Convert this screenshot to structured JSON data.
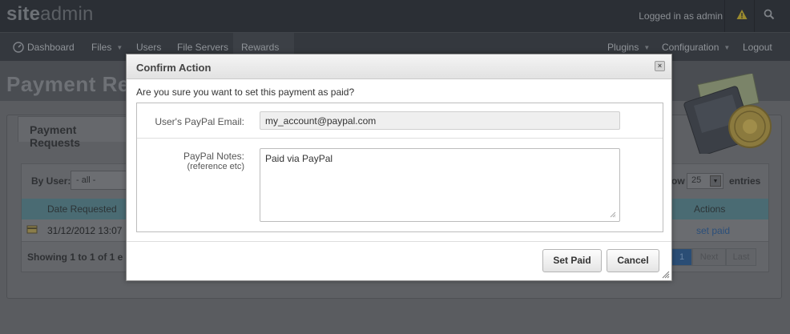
{
  "app": {
    "brand_site": "site",
    "brand_admin": "admin"
  },
  "topbar": {
    "logged_in_text": "Logged in as admin",
    "icons": [
      "warning-icon",
      "search-icon"
    ]
  },
  "nav": {
    "left": [
      {
        "label": "Dashboard",
        "has_caret": false
      },
      {
        "label": "Files",
        "has_caret": true
      },
      {
        "label": "Users",
        "has_caret": false
      },
      {
        "label": "File Servers",
        "has_caret": false
      },
      {
        "label": "Rewards",
        "has_caret": true
      }
    ],
    "right": [
      {
        "label": "Plugins",
        "has_caret": true
      },
      {
        "label": "Configuration",
        "has_caret": true
      },
      {
        "label": "Logout",
        "has_caret": false
      }
    ]
  },
  "page": {
    "title": "Payment Requ",
    "panel_tab": "Payment Requests",
    "filter": {
      "by_user_label": "By User:",
      "by_user_value": "- all -"
    },
    "length": {
      "show_label": "ow",
      "value": "25",
      "entries_label": "entries"
    },
    "table": {
      "headers": {
        "date": "Date Requested",
        "actions": "Actions"
      },
      "rows": [
        {
          "date": "31/12/2012 13:07",
          "action": "set paid"
        }
      ]
    },
    "showing_text": "Showing 1 to 1 of 1 e",
    "pagination": {
      "current": "1",
      "next": "Next",
      "last": "Last"
    }
  },
  "modal": {
    "title": "Confirm Action",
    "close_label": "×",
    "question": "Are you sure you want to set this payment as paid?",
    "email_label": "User's PayPal Email:",
    "email_value": "my_account@paypal.com",
    "notes_label": "PayPal Notes:",
    "notes_sub": "(reference etc)",
    "notes_value": "Paid via PayPal",
    "set_paid_label": "Set Paid",
    "cancel_label": "Cancel"
  },
  "colors": {
    "accent": "#2a4d75",
    "overlay": "#5a5c60",
    "header": "#2b2f35"
  }
}
